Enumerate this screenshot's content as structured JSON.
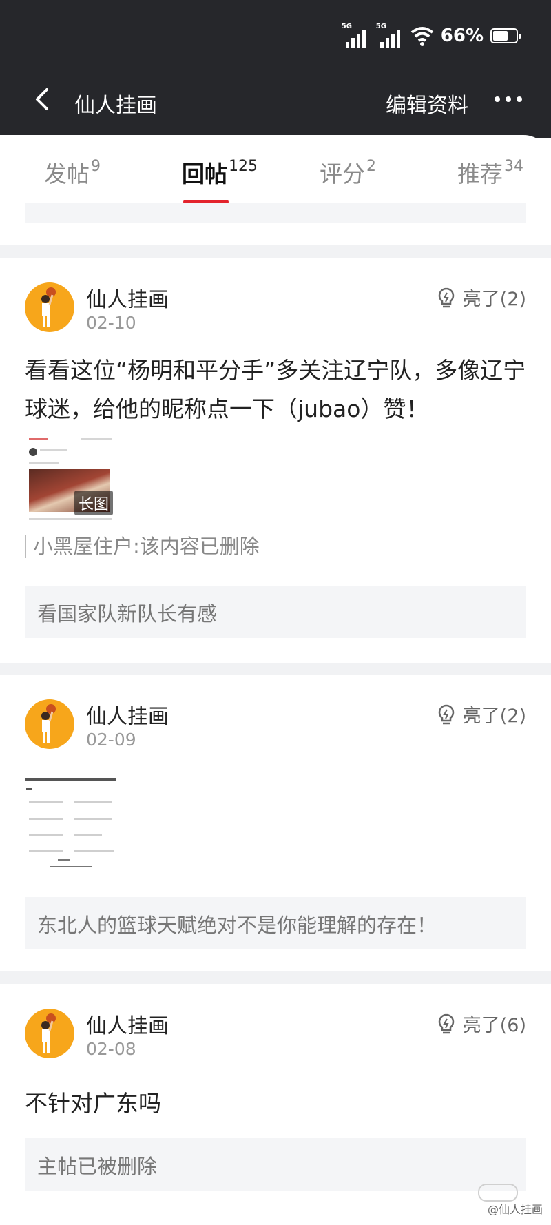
{
  "status_bar": {
    "network_1": "5G",
    "network_2": "5G",
    "battery": "66%",
    "battery_level": 0.66
  },
  "nav": {
    "title": "仙人挂画",
    "edit_label": "编辑资料"
  },
  "tabs": [
    {
      "label": "发帖",
      "count": "9"
    },
    {
      "label": "回帖",
      "count": "125"
    },
    {
      "label": "评分",
      "count": "2"
    },
    {
      "label": "推荐",
      "count": "34"
    }
  ],
  "posts": [
    {
      "author": "仙人挂画",
      "date": "02-10",
      "likes": "亮了(2)",
      "text": "看看这位“杨明和平分手”多关注辽宁队，多像辽宁球迷，给他的昵称点一下（jubao）赞！",
      "image_tag": "长图",
      "quote": "小黑屋住户:该内容已删除",
      "reference": "看国家队新队长有感"
    },
    {
      "author": "仙人挂画",
      "date": "02-09",
      "likes": "亮了(2)",
      "reference": "东北人的篮球天赋绝对不是你能理解的存在！"
    },
    {
      "author": "仙人挂画",
      "date": "02-08",
      "likes": "亮了(6)",
      "text": "不针对广东吗",
      "reference": "主帖已被删除"
    }
  ],
  "watermark": "@仙人挂画",
  "colors": {
    "header_bg": "#26272b",
    "accent": "#e3232c",
    "avatar_bg": "#f7a61b"
  }
}
